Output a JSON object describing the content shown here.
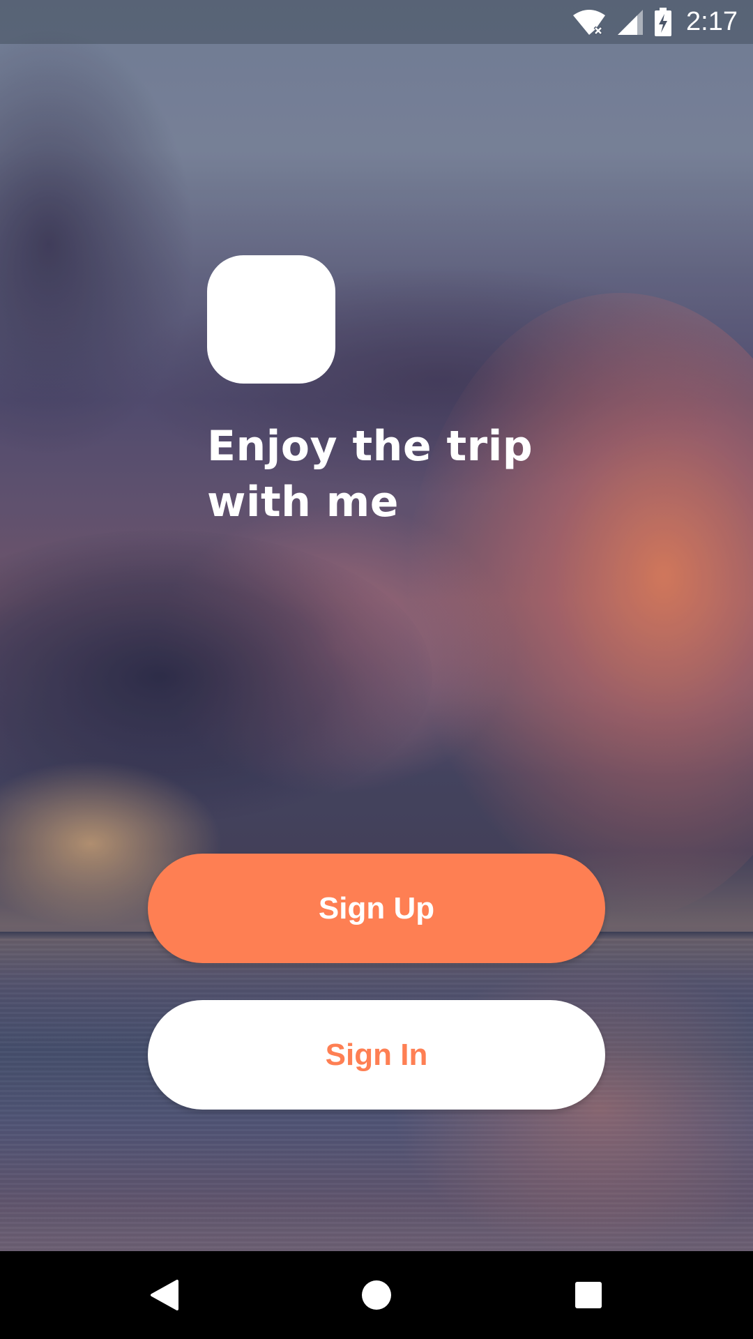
{
  "status_bar": {
    "time": "2:17",
    "icons": [
      "wifi-no-internet-icon",
      "cell-signal-icon",
      "battery-charging-icon"
    ]
  },
  "background": {
    "image": "sunset-clouds-over-sea",
    "colors": {
      "sky_top": "#7d8aa2",
      "cloud_glow": "#ff8c5f",
      "sea": "#5a5e80"
    }
  },
  "logo": {
    "icon": "app-logo-placeholder",
    "color": "#ffffff"
  },
  "headline": {
    "line1": "Enjoy the trip",
    "line2": "with me"
  },
  "actions": {
    "sign_up_label": "Sign Up",
    "sign_in_label": "Sign In",
    "accent_color": "#fe7f53"
  },
  "nav_bar": {
    "buttons": [
      "back-icon",
      "home-icon",
      "recents-icon"
    ]
  }
}
